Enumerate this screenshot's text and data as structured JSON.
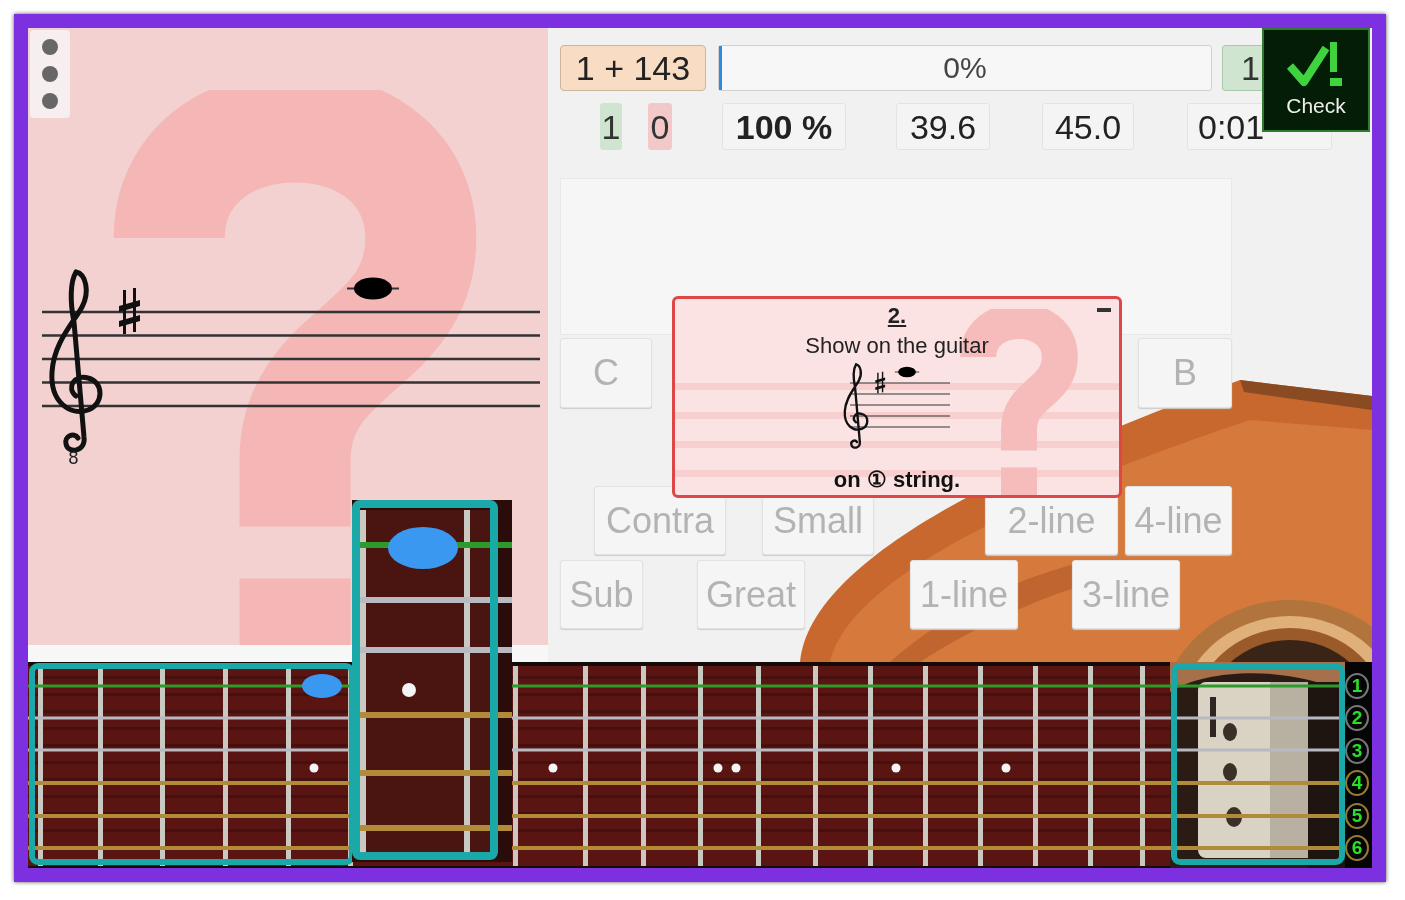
{
  "score": {
    "clef_octave": "8"
  },
  "toolbar": {
    "question_count": "1 + 143",
    "progress": {
      "label": "0%",
      "level": 0
    },
    "answered": "1"
  },
  "stats": [
    {
      "text": "1",
      "kind": "correct"
    },
    {
      "text": "0",
      "kind": "wrong"
    },
    {
      "text": "100 %",
      "kind": "effectiveness"
    },
    {
      "text": "39.6",
      "kind": "plain"
    },
    {
      "text": "45.0",
      "kind": "plain"
    },
    {
      "text": "0:01",
      "kind": "plain"
    }
  ],
  "check_button": {
    "label": "Check"
  },
  "note_buttons": [
    {
      "label": "C"
    },
    {
      "label": "B"
    }
  ],
  "octave_rows": [
    {
      "buttons": [
        {
          "label": "Contra"
        },
        {
          "label": "Small"
        },
        {
          "label": "2-line"
        },
        {
          "label": "4-line"
        }
      ]
    },
    {
      "buttons": [
        {
          "label": "Sub"
        },
        {
          "label": "Great"
        },
        {
          "label": "1-line"
        },
        {
          "label": "3-line"
        }
      ]
    }
  ],
  "tip": {
    "number": "2.",
    "text": "Show on the guitar",
    "footer": "on ① string."
  },
  "fretboard": {
    "strings": [
      {
        "label": "1",
        "kind": "plain",
        "highlighted": true
      },
      {
        "label": "2",
        "kind": "plain",
        "highlighted": false
      },
      {
        "label": "3",
        "kind": "plain",
        "highlighted": false
      },
      {
        "label": "4",
        "kind": "wound",
        "highlighted": false
      },
      {
        "label": "5",
        "kind": "wound",
        "highlighted": false
      },
      {
        "label": "6",
        "kind": "wound",
        "highlighted": false
      }
    ]
  }
}
